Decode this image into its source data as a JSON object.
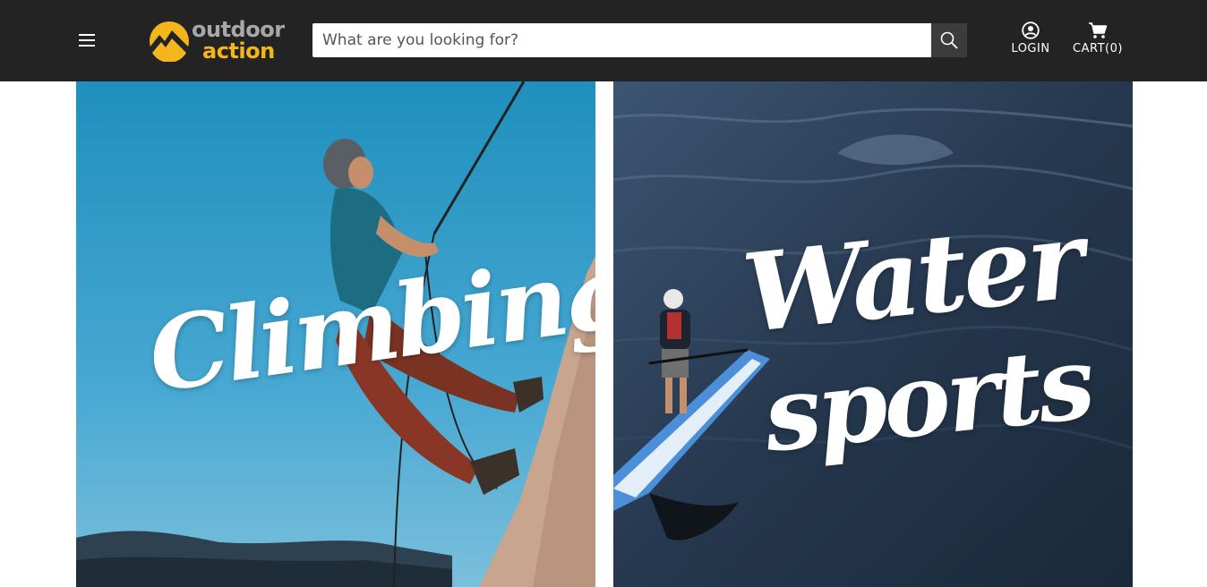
{
  "header": {
    "menu_icon": "hamburger-menu-icon",
    "logo": {
      "line1": "outdoor",
      "line2": "action",
      "icon": "sun-mountain-logo-icon",
      "colors": {
        "grey": "#a8a8a8",
        "yellow": "#f5b51c"
      }
    },
    "search": {
      "placeholder": "What are you looking for?",
      "value": "",
      "button_icon": "search-icon"
    },
    "login": {
      "label": "LOGIN",
      "icon": "user-circle-icon"
    },
    "cart": {
      "label": "CART(0)",
      "icon": "shopping-cart-icon"
    },
    "background": "#232323"
  },
  "categories": [
    {
      "title": "Climbing",
      "scene": "rock-climber-on-cliff"
    },
    {
      "title_line1": "Water",
      "title_line2": "sports",
      "scene": "paddleboarder-on-water"
    }
  ]
}
